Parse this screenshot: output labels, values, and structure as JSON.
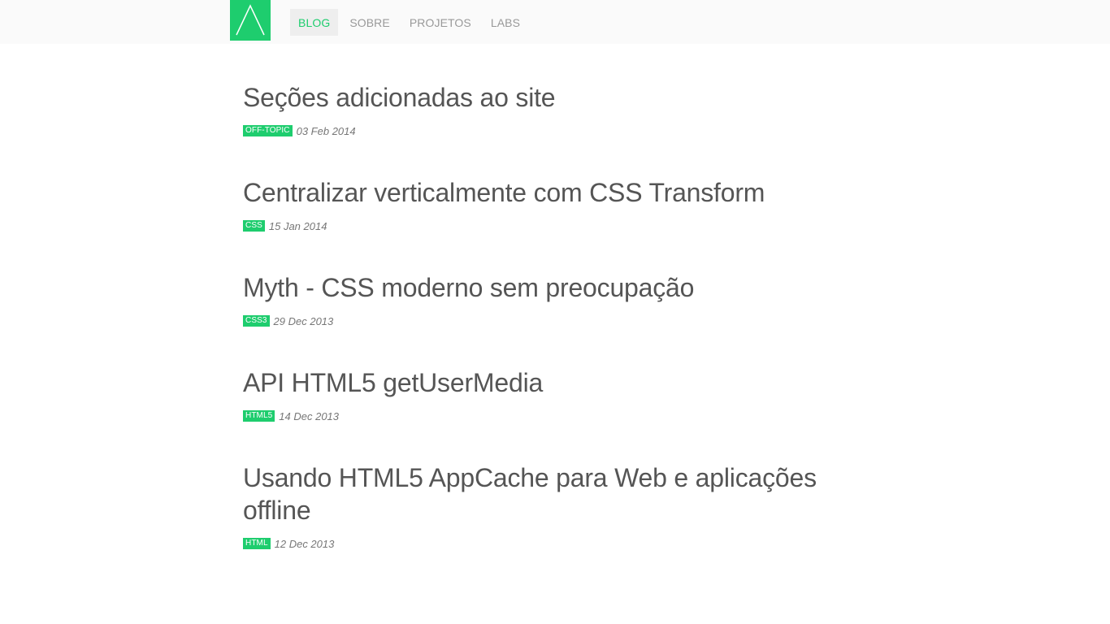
{
  "brand": {
    "logo_color": "#1ecd6e",
    "logo_icon": "caret-up-icon"
  },
  "nav": {
    "items": [
      {
        "label": "BLOG",
        "active": true
      },
      {
        "label": "SOBRE",
        "active": false
      },
      {
        "label": "PROJETOS",
        "active": false
      },
      {
        "label": "LABS",
        "active": false
      }
    ]
  },
  "posts": [
    {
      "title": "Seções adicionadas ao site",
      "tag": "OFF-TOPIC",
      "date": "03 Feb 2014"
    },
    {
      "title": "Centralizar verticalmente com CSS Transform",
      "tag": "CSS",
      "date": "15 Jan 2014"
    },
    {
      "title": "Myth - CSS moderno sem preocupação",
      "tag": "CSS3",
      "date": "29 Dec 2013"
    },
    {
      "title": "API HTML5 getUserMedia",
      "tag": "HTML5",
      "date": "14 Dec 2013"
    },
    {
      "title": "Usando HTML5 AppCache para Web e aplicações offline",
      "tag": "HTML",
      "date": "12 Dec 2013"
    }
  ],
  "colors": {
    "accent": "#1ecd6e",
    "text": "#555555",
    "nav_text": "#999999",
    "navbar_bg": "#fafafa"
  }
}
